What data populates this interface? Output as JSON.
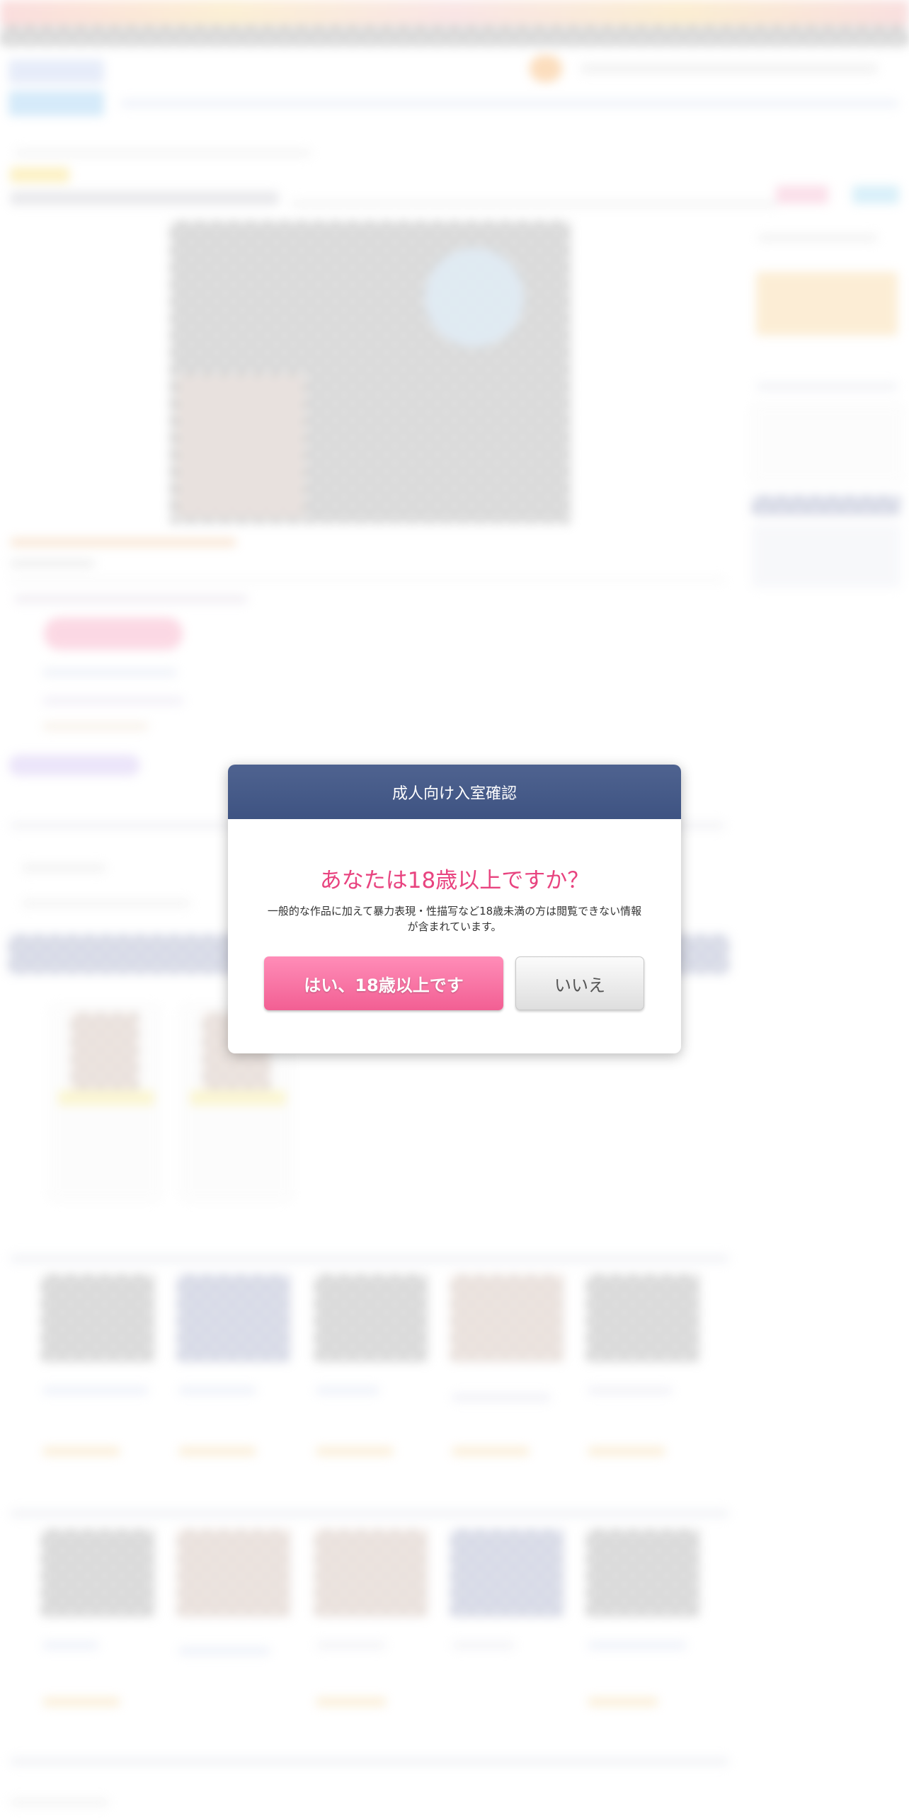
{
  "age_gate": {
    "title": "成人向け入室確認",
    "question": "あなたは18歳以上ですか？",
    "notice": "一般的な作品に加えて暴力表現・性描写など18歳未満の方は閲覧できない情報が含まれています。",
    "yes_label": "はい、18歳以上です",
    "no_label": "いいえ"
  },
  "colors": {
    "header_bg": "#46598a",
    "question_text": "#e8437f",
    "yes_button": "#f25f93",
    "no_button": "#e4e4e4"
  }
}
